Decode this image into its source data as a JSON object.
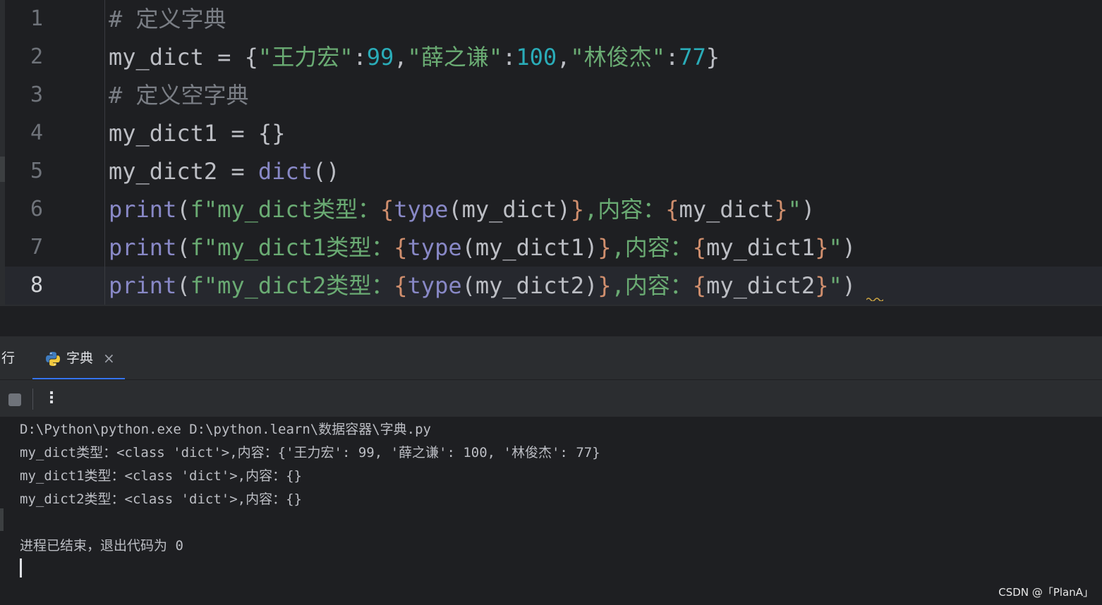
{
  "editor": {
    "line_numbers": [
      "1",
      "2",
      "3",
      "4",
      "5",
      "6",
      "7",
      "8"
    ],
    "current_line": "8",
    "lines": [
      [
        {
          "t": "# ",
          "c": "c-comment"
        },
        {
          "t": "定义字典",
          "c": "c-comment cjk"
        }
      ],
      [
        {
          "t": "my_dict = {",
          "c": ""
        },
        {
          "t": "\"",
          "c": "c-str"
        },
        {
          "t": "王力宏",
          "c": "c-str cjk"
        },
        {
          "t": "\"",
          "c": "c-str"
        },
        {
          "t": ":",
          "c": ""
        },
        {
          "t": "99",
          "c": "c-num"
        },
        {
          "t": ",",
          "c": ""
        },
        {
          "t": "\"",
          "c": "c-str"
        },
        {
          "t": "薛之谦",
          "c": "c-str cjk"
        },
        {
          "t": "\"",
          "c": "c-str"
        },
        {
          "t": ":",
          "c": ""
        },
        {
          "t": "100",
          "c": "c-num"
        },
        {
          "t": ",",
          "c": ""
        },
        {
          "t": "\"",
          "c": "c-str"
        },
        {
          "t": "林俊杰",
          "c": "c-str cjk"
        },
        {
          "t": "\"",
          "c": "c-str"
        },
        {
          "t": ":",
          "c": ""
        },
        {
          "t": "77",
          "c": "c-num"
        },
        {
          "t": "}",
          "c": ""
        }
      ],
      [
        {
          "t": "# ",
          "c": "c-comment"
        },
        {
          "t": "定义空字典",
          "c": "c-comment cjk"
        }
      ],
      [
        {
          "t": "my_dict1 = {}",
          "c": ""
        }
      ],
      [
        {
          "t": "my_dict2 = ",
          "c": ""
        },
        {
          "t": "dict",
          "c": "c-builtin"
        },
        {
          "t": "()",
          "c": ""
        }
      ],
      [
        {
          "t": "print",
          "c": "c-builtin"
        },
        {
          "t": "(",
          "c": ""
        },
        {
          "t": "f\"my_dict",
          "c": "c-fstr"
        },
        {
          "t": "类型：",
          "c": "c-fstr cjk"
        },
        {
          "t": "{",
          "c": "c-brace"
        },
        {
          "t": "type",
          "c": "c-builtin"
        },
        {
          "t": "(my_dict)",
          "c": ""
        },
        {
          "t": "}",
          "c": "c-brace"
        },
        {
          "t": ",",
          "c": "c-fstr"
        },
        {
          "t": "内容：",
          "c": "c-fstr cjk"
        },
        {
          "t": "{",
          "c": "c-brace"
        },
        {
          "t": "my_dict",
          "c": ""
        },
        {
          "t": "}",
          "c": "c-brace"
        },
        {
          "t": "\"",
          "c": "c-fstr"
        },
        {
          "t": ")",
          "c": ""
        }
      ],
      [
        {
          "t": "print",
          "c": "c-builtin"
        },
        {
          "t": "(",
          "c": ""
        },
        {
          "t": "f\"my_dict1",
          "c": "c-fstr"
        },
        {
          "t": "类型：",
          "c": "c-fstr cjk"
        },
        {
          "t": "{",
          "c": "c-brace"
        },
        {
          "t": "type",
          "c": "c-builtin"
        },
        {
          "t": "(my_dict1)",
          "c": ""
        },
        {
          "t": "}",
          "c": "c-brace"
        },
        {
          "t": ",",
          "c": "c-fstr"
        },
        {
          "t": "内容：",
          "c": "c-fstr cjk"
        },
        {
          "t": "{",
          "c": "c-brace"
        },
        {
          "t": "my_dict1",
          "c": ""
        },
        {
          "t": "}",
          "c": "c-brace"
        },
        {
          "t": "\"",
          "c": "c-fstr"
        },
        {
          "t": ")",
          "c": ""
        }
      ],
      [
        {
          "t": "print",
          "c": "c-builtin"
        },
        {
          "t": "(",
          "c": ""
        },
        {
          "t": "f\"my_dict2",
          "c": "c-fstr"
        },
        {
          "t": "类型：",
          "c": "c-fstr cjk"
        },
        {
          "t": "{",
          "c": "c-brace"
        },
        {
          "t": "type",
          "c": "c-builtin"
        },
        {
          "t": "(my_dict2)",
          "c": ""
        },
        {
          "t": "}",
          "c": "c-brace"
        },
        {
          "t": ",",
          "c": "c-fstr"
        },
        {
          "t": "内容：",
          "c": "c-fstr cjk"
        },
        {
          "t": "{",
          "c": "c-brace"
        },
        {
          "t": "my_dict2",
          "c": ""
        },
        {
          "t": "}",
          "c": "c-brace"
        },
        {
          "t": "\"",
          "c": "c-fstr"
        },
        {
          "t": ")",
          "c": ""
        }
      ]
    ]
  },
  "run_panel": {
    "label": "行",
    "tab": {
      "label": "字典",
      "icon": "python-icon",
      "close": "×"
    },
    "toolbar": {
      "stop_icon": "stop-icon",
      "more": "⋮"
    }
  },
  "console": {
    "lines": [
      "D:\\Python\\python.exe D:\\python.learn\\数据容器\\字典.py",
      "my_dict类型：<class 'dict'>,内容：{'王力宏': 99, '薛之谦': 100, '林俊杰': 77}",
      "my_dict1类型：<class 'dict'>,内容：{}",
      "my_dict2类型：<class 'dict'>,内容：{}",
      "",
      "进程已结束，退出代码为 0"
    ]
  },
  "watermark": "CSDN @「PlanA」",
  "colors": {
    "background": "#1e1f22",
    "comment": "#7a7e85",
    "string": "#6aab73",
    "number": "#2aacb8",
    "builtin": "#8888c6",
    "brace": "#cf8e6d",
    "tab_underline": "#3574f0"
  }
}
